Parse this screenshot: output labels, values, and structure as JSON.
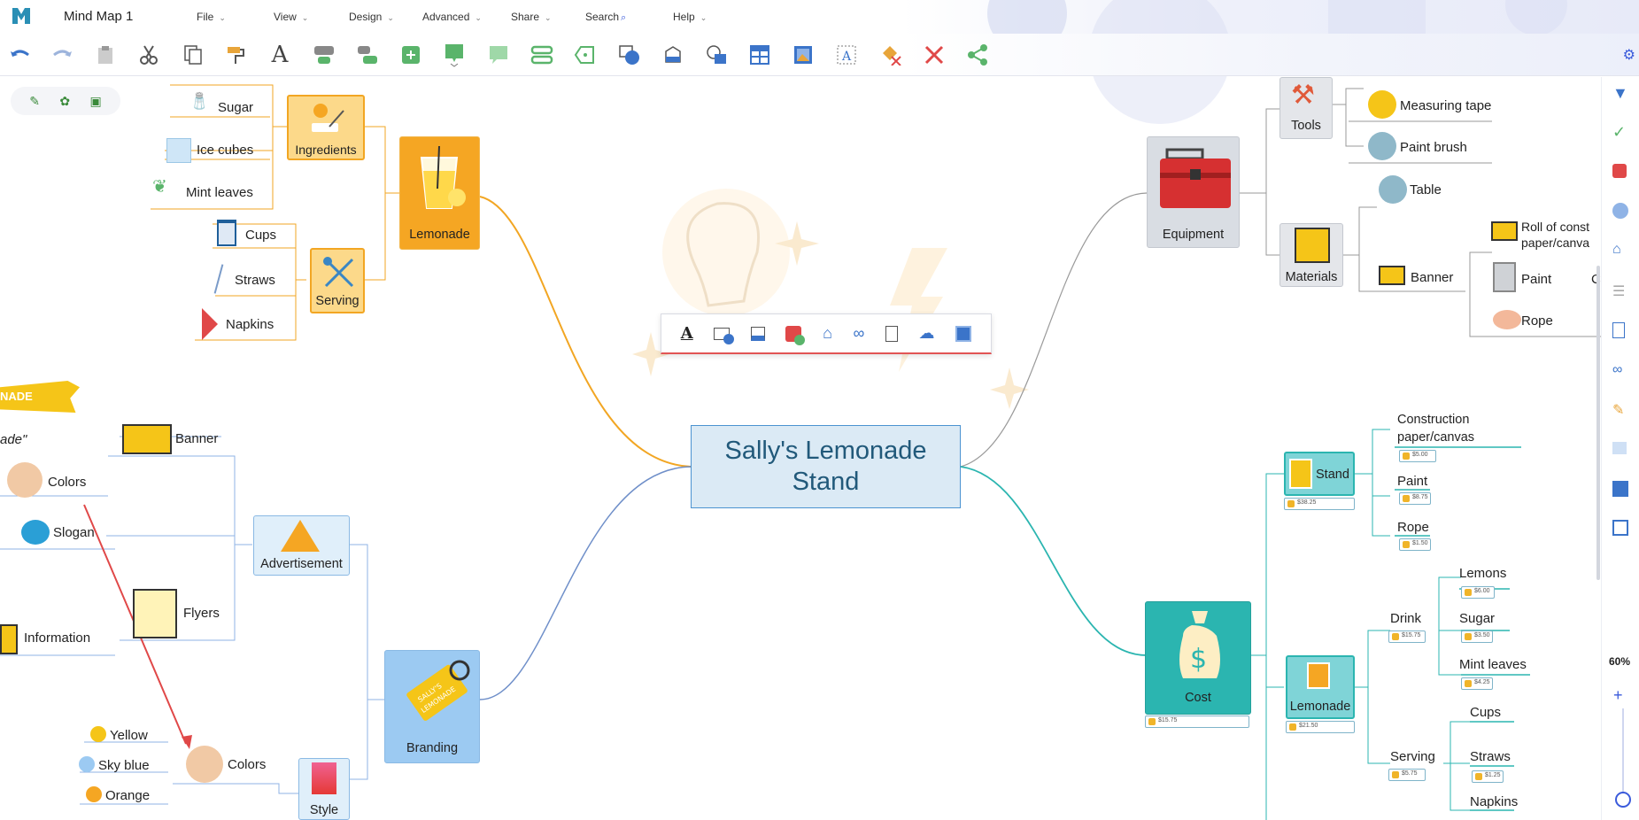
{
  "app": {
    "doc_title": "Mind Map 1"
  },
  "menu": [
    {
      "label": "File"
    },
    {
      "label": "View"
    },
    {
      "label": "Design"
    },
    {
      "label": "Advanced"
    },
    {
      "label": "Share"
    },
    {
      "label": "Search"
    },
    {
      "label": "Help"
    }
  ],
  "toolbar": {
    "icons": [
      "undo-icon",
      "redo-icon",
      "paste-icon",
      "cut-icon",
      "copy-icon",
      "format-painter-icon",
      "text-icon",
      "add-topic-icon",
      "add-subtopic-icon",
      "add-floating-icon",
      "callout-icon",
      "comment-icon",
      "relationship-icon",
      "boundary-icon",
      "shape-icon",
      "fill-icon",
      "add-image-icon",
      "table-icon",
      "insert-image-icon",
      "text-style-icon",
      "clear-format-icon",
      "delete-icon",
      "share-icon"
    ]
  },
  "central": {
    "title": "Sally's Lemonade Stand"
  },
  "nodes": {
    "lemonade": "Lemonade",
    "ingredients": "Ingredients",
    "sugar": "Sugar",
    "ice_cubes": "Ice cubes",
    "mint_leaves": "Mint leaves",
    "serving": "Serving",
    "cups": "Cups",
    "straws": "Straws",
    "napkins": "Napkins",
    "equipment": "Equipment",
    "tools": "Tools",
    "measuring_tape": "Measuring tape",
    "paint_brush": "Paint brush",
    "materials": "Materials",
    "table": "Table",
    "banner_r": "Banner",
    "roll_of_const": "Roll of const",
    "paper_canva": "paper/canva",
    "paint": "Paint",
    "rope": "Rope",
    "c_cut": "C",
    "cost": "Cost",
    "stand": "Stand",
    "construction": "Construction",
    "construction2": "paper/canvas",
    "cost_paint": "Paint",
    "cost_rope": "Rope",
    "drink": "Drink",
    "lemons": "Lemons",
    "cost_sugar": "Sugar",
    "cost_mint": "Mint leaves",
    "cost_lemonade": "Lemonade",
    "cost_serving": "Serving",
    "cost_cups": "Cups",
    "cost_straws": "Straws",
    "cost_napkins": "Napkins",
    "branding": "Branding",
    "advertisement": "Advertisement",
    "banner_l": "Banner",
    "colors": "Colors",
    "slogan": "Slogan",
    "information": "Information",
    "flyers": "Flyers",
    "style_colors": "Colors",
    "yellow": "Yellow",
    "sky_blue": "Sky blue",
    "orange": "Orange",
    "style": "Style",
    "ade_quote": "ade\"",
    "nade_banner": "NADE"
  },
  "costs": {
    "stand": "$38.25",
    "construction": "$5.00",
    "paint": "$8.75",
    "rope": "$1.50",
    "cost_total": "$15.75",
    "lemonade": "$21.50",
    "drink": "$15.75",
    "lemons": "$6.00",
    "sugar": "$3.50",
    "mint": "$4.25",
    "serving": "$5.75",
    "straws": "$1.25"
  },
  "zoom": {
    "label": "60%"
  },
  "colors": {
    "accent": "#3b5bdb",
    "lemonade_orange": "#f5a623",
    "teal": "#2bb5b0",
    "blue_link": "#4b93d1"
  }
}
